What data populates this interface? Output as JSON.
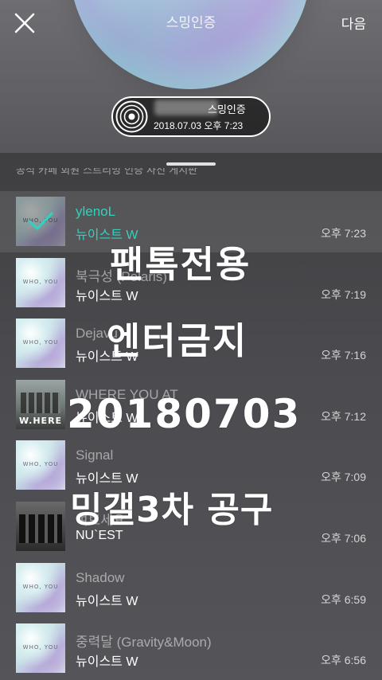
{
  "header": {
    "title": "스밍인증",
    "next_label": "다음",
    "badge": {
      "title": "스밍인증",
      "timestamp": "2018.07.03 오후 7:23"
    }
  },
  "sheet": {
    "cut_text": "공식 카페 회원 스트리밍 인증 사진 게시판"
  },
  "songs": [
    {
      "title": "ylenoL",
      "artist": "뉴이스트 W",
      "time": "오후 7:23",
      "selected": true,
      "art": "whoyou"
    },
    {
      "title": "북극성 (Polaris)",
      "artist": "뉴이스트 W",
      "time": "오후 7:19",
      "art": "whoyou"
    },
    {
      "title": "Dejavu",
      "artist": "뉴이스트 W",
      "time": "오후 7:16",
      "art": "whoyou"
    },
    {
      "title": "WHERE YOU AT",
      "artist": "뉴이스트 W",
      "time": "오후 7:12",
      "art": "where"
    },
    {
      "title": "Signal",
      "artist": "뉴이스트 W",
      "time": "오후 7:09",
      "art": "whoyou"
    },
    {
      "title": "여보세요",
      "artist": "NU`EST",
      "time": "오후 7:06",
      "art": "nuest"
    },
    {
      "title": "Shadow",
      "artist": "뉴이스트 W",
      "time": "오후 6:59",
      "art": "whoyou"
    },
    {
      "title": "중력달 (Gravity&Moon)",
      "artist": "뉴이스트 W",
      "time": "오후 6:56",
      "art": "whoyou"
    }
  ],
  "album_art": {
    "whoyou_text": "WHO, YOU",
    "where_text": "W.HERE"
  },
  "overlay": {
    "line1": "팬톡전용",
    "line2": "엔터금지",
    "line3": "20180703",
    "line4": "밍갤3차 공구"
  },
  "icons": {
    "close": "close-icon",
    "check": "check-icon",
    "disc": "vinyl-disc-icon"
  },
  "colors": {
    "accent": "#34d0bd",
    "background": "#4a4a4d"
  }
}
